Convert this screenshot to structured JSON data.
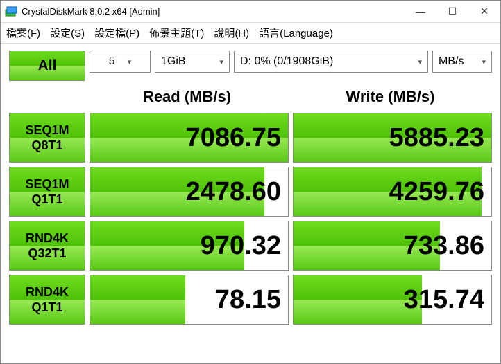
{
  "window": {
    "title": "CrystalDiskMark 8.0.2 x64 [Admin]",
    "minimize": "—",
    "maximize": "☐",
    "close": "✕"
  },
  "menu": {
    "file": "檔案(F)",
    "settings": "設定(S)",
    "profile": "設定檔(P)",
    "theme": "佈景主題(T)",
    "help": "說明(H)",
    "language": "語言(Language)"
  },
  "controls": {
    "all_label": "All",
    "runs": "5",
    "size": "1GiB",
    "drive": "D: 0% (0/1908GiB)",
    "unit": "MB/s"
  },
  "headers": {
    "read": "Read (MB/s)",
    "write": "Write (MB/s)"
  },
  "rows": [
    {
      "line1": "SEQ1M",
      "line2": "Q8T1",
      "read": "7086.75",
      "read_pct": 100,
      "write": "5885.23",
      "write_pct": 100
    },
    {
      "line1": "SEQ1M",
      "line2": "Q1T1",
      "read": "2478.60",
      "read_pct": 88,
      "write": "4259.76",
      "write_pct": 95
    },
    {
      "line1": "RND4K",
      "line2": "Q32T1",
      "read": "970.32",
      "read_pct": 78,
      "write": "733.86",
      "write_pct": 74
    },
    {
      "line1": "RND4K",
      "line2": "Q1T1",
      "read": "78.15",
      "read_pct": 48,
      "write": "315.74",
      "write_pct": 65
    }
  ]
}
